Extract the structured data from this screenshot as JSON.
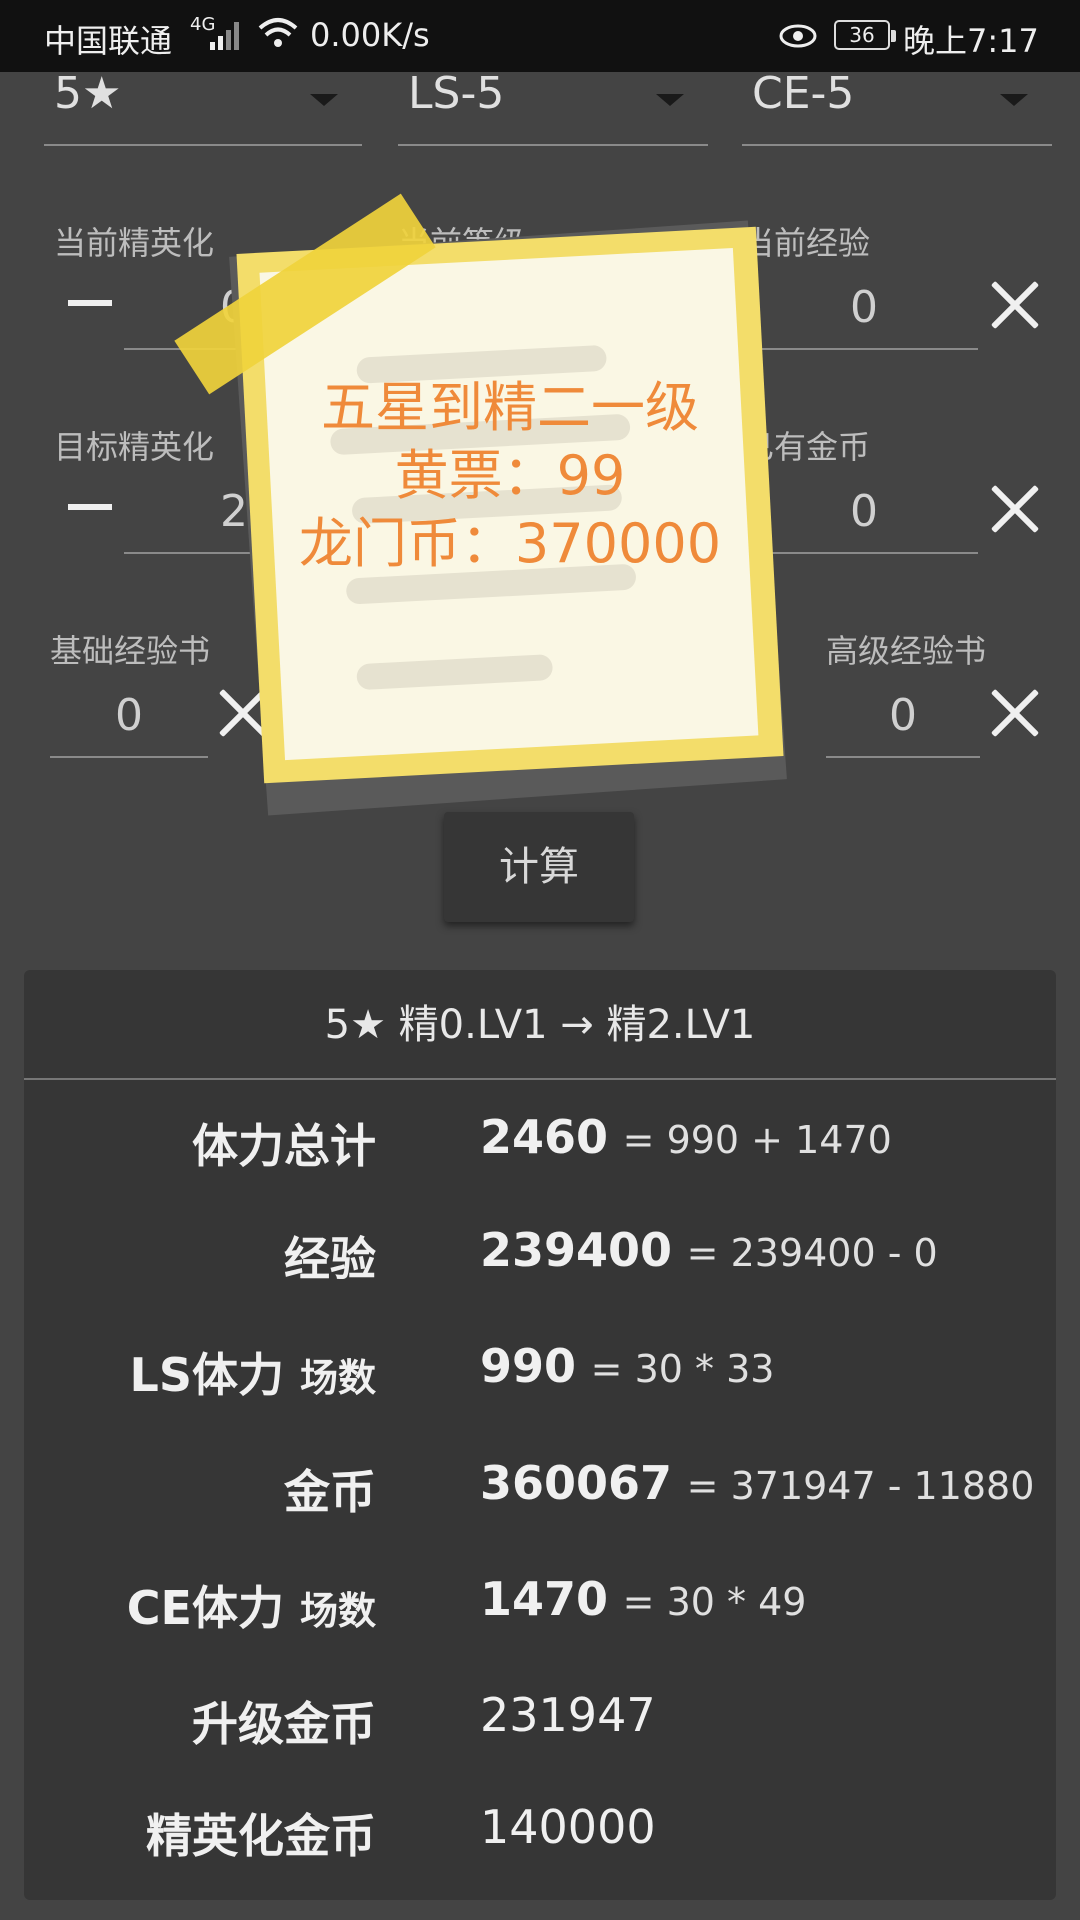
{
  "status_bar": {
    "carrier": "中国联通",
    "network": "4G",
    "speed": "0.00K/s",
    "battery": "36",
    "time": "晚上7:17"
  },
  "selectors": {
    "star": "5★",
    "ls_stage": "LS-5",
    "ce_stage": "CE-5"
  },
  "fields": {
    "current_elite_label": "当前精英化",
    "current_elite": "0",
    "current_level_label": "当前等级",
    "current_exp_label": "当前经验",
    "current_exp": "0",
    "target_elite_label": "目标精英化",
    "target_elite": "2",
    "owned_gold_label": "已有金币",
    "owned_gold": "0",
    "basic_book_label": "基础经验书",
    "basic_book": "0",
    "advanced_book_label": "高级经验书",
    "advanced_book": "0"
  },
  "calc_button": "计算",
  "sticky_note": {
    "line1": "五星到精二一级",
    "line2": "黄票：99",
    "line3": "龙门币：370000"
  },
  "result": {
    "header": "5★ 精0.LV1 → 精2.LV1",
    "rows": [
      {
        "label": "体力总计",
        "sub": "",
        "value": "2460",
        "formula": "= 990 + 1470"
      },
      {
        "label": "经验",
        "sub": "",
        "value": "239400",
        "formula": "= 239400 - 0"
      },
      {
        "label": "LS体力",
        "sub": "场数",
        "value": "990",
        "formula": "= 30 * 33"
      },
      {
        "label": "金币",
        "sub": "",
        "value": "360067",
        "formula": "= 371947 - 11880"
      },
      {
        "label": "CE体力",
        "sub": "场数",
        "value": "1470",
        "formula": "= 30 * 49"
      },
      {
        "label": "升级金币",
        "sub": "",
        "value": "231947",
        "formula": ""
      },
      {
        "label": "精英化金币",
        "sub": "",
        "value": "140000",
        "formula": ""
      }
    ]
  },
  "colors": {
    "background": "#444444",
    "note_text": "#ef8a3a",
    "note_paper": "#faf7e4",
    "tape": "#f0d23c"
  }
}
